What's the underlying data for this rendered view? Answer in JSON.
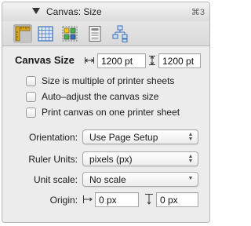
{
  "panel": {
    "title": "Canvas: Size",
    "shortcut": "⌘3"
  },
  "toolbar": {
    "tools": [
      {
        "name": "canvas-size",
        "icon": "ruler-square-icon",
        "selected": true
      },
      {
        "name": "grid",
        "icon": "grid-icon",
        "selected": false
      },
      {
        "name": "alignment",
        "icon": "alignment-icon",
        "selected": false
      },
      {
        "name": "background",
        "icon": "document-icon",
        "selected": false
      },
      {
        "name": "layers",
        "icon": "layers-icon",
        "selected": false
      }
    ]
  },
  "canvas_size": {
    "label": "Canvas Size",
    "width_value": "1200 pt",
    "height_value": "1200 pt"
  },
  "options": {
    "multiple_of_sheets": "Size is multiple of printer sheets",
    "auto_adjust": "Auto–adjust the canvas size",
    "print_one_sheet": "Print canvas on one printer sheet"
  },
  "orientation": {
    "label": "Orientation:",
    "value": "Use Page Setup"
  },
  "ruler_units": {
    "label": "Ruler Units:",
    "value": "pixels (px)"
  },
  "unit_scale": {
    "label": "Unit scale:",
    "value": "No scale"
  },
  "origin": {
    "label": "Origin:",
    "x_value": "0 px",
    "y_value": "0 px"
  },
  "colors": {
    "panel_bg": "#ececec",
    "selected_tool_bg": "#c4c4c4",
    "icon_gold": "#d9a521",
    "icon_blue": "#3b6fb8"
  }
}
